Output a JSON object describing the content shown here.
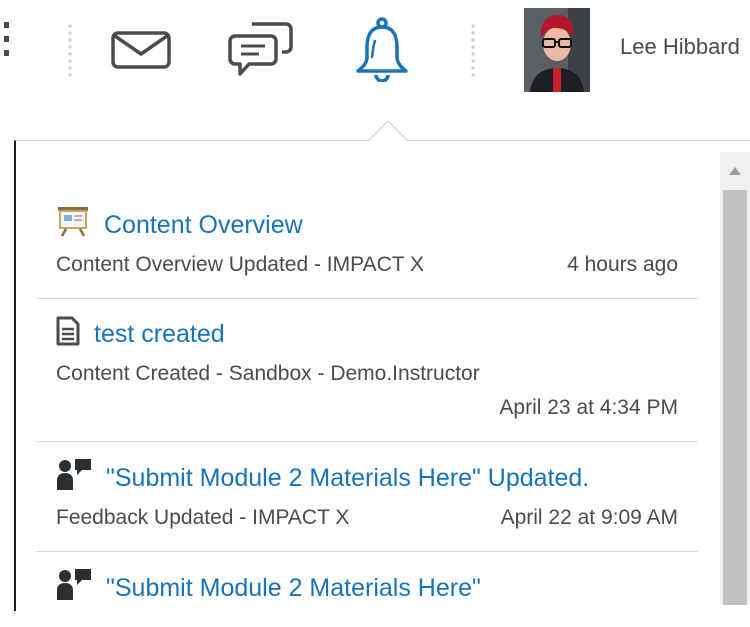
{
  "header": {
    "user_name": "Lee Hibbard",
    "icons": [
      "more-icon",
      "mail-icon",
      "chat-icon",
      "bell-icon"
    ]
  },
  "notifications": {
    "items": [
      {
        "icon": "presentation-icon",
        "title": "Content Overview",
        "subtitle": "Content Overview Updated - IMPACT X",
        "time": "4 hours ago"
      },
      {
        "icon": "document-icon",
        "title": "test created",
        "subtitle": "Content Created - Sandbox - Demo.Instructor",
        "time": "April 23 at 4:34 PM"
      },
      {
        "icon": "feedback-icon",
        "title": "\"Submit Module 2 Materials Here\" Updated.",
        "subtitle": "Feedback Updated - IMPACT X",
        "time": "April 22 at 9:09 AM"
      },
      {
        "icon": "feedback-icon",
        "title": "\"Submit Module 2 Materials Here\"",
        "subtitle": "",
        "time": ""
      }
    ]
  },
  "colors": {
    "link": "#1a73b6",
    "active_icon": "#1a73b6",
    "text": "#494c4e",
    "divider": "#d3d9e3"
  }
}
